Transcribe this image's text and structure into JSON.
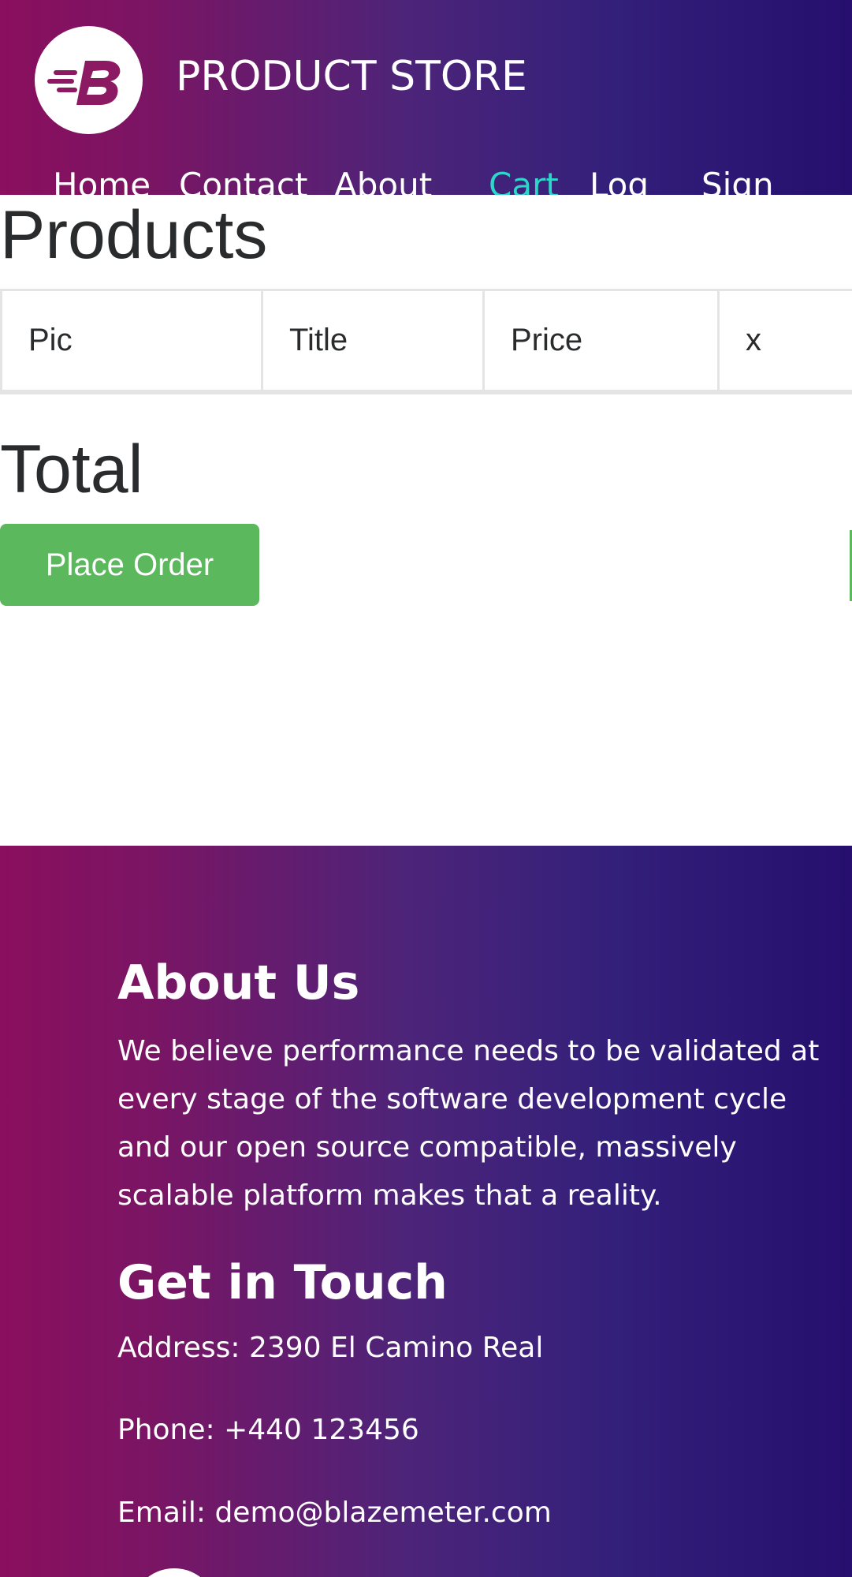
{
  "header": {
    "brand": "PRODUCT STORE",
    "logo_icon": "blazemeter-b-logo-icon",
    "nav": [
      {
        "label": "Home"
      },
      {
        "label": "Contact"
      },
      {
        "label": "About"
      },
      {
        "label": "Cart"
      },
      {
        "label": "Log"
      },
      {
        "label": "Sign"
      }
    ]
  },
  "main": {
    "products_title": "Products",
    "table_headers": [
      "Pic",
      "Title",
      "Price",
      "x"
    ],
    "total_title": "Total",
    "place_order_label": "Place Order"
  },
  "footer": {
    "about_title": "About Us",
    "about_text": "We believe performance needs to be validated at every stage of the software development cycle and our open source compatible, massively scalable platform makes that a reality.",
    "touch_title": "Get in Touch",
    "address": "Address: 2390 El Camino Real",
    "phone": "Phone: +440 123456",
    "email": "Email: demo@blazemeter.com"
  },
  "colors": {
    "gradient_start": "#8a0f5e",
    "gradient_end": "#260f6e",
    "active_nav": "#2cd6c8",
    "order_button": "#5cb85c"
  }
}
